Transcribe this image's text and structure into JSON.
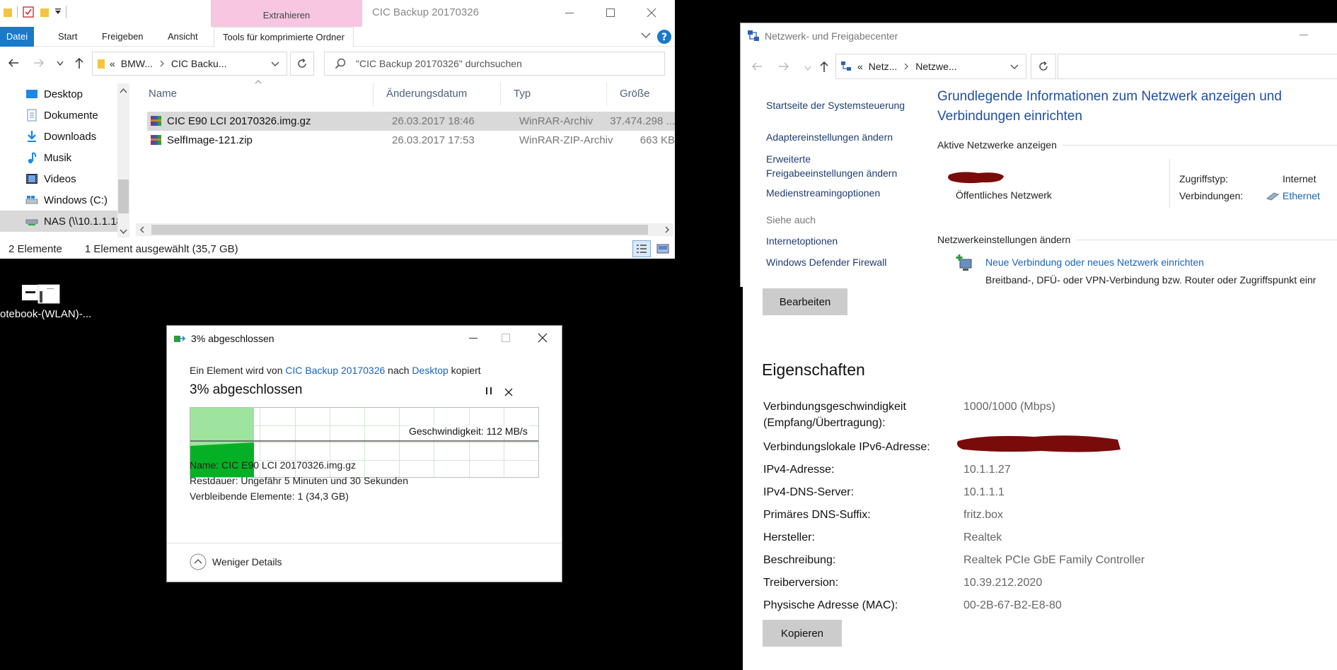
{
  "explorer": {
    "title": "CIC Backup 20170326",
    "contextual_tab": "Extrahieren",
    "ribbon_tabs": [
      "Datei",
      "Start",
      "Freigeben",
      "Ansicht",
      "Tools für komprimierte Ordner"
    ],
    "breadcrumb_sep": "«",
    "breadcrumb": [
      "BMW...",
      "CIC Backu..."
    ],
    "search_placeholder": "\"CIC Backup 20170326\" durchsuchen",
    "nav_items": [
      {
        "label": "Desktop",
        "icon": "desktop-folder-icon"
      },
      {
        "label": "Dokumente",
        "icon": "documents-folder-icon"
      },
      {
        "label": "Downloads",
        "icon": "downloads-folder-icon"
      },
      {
        "label": "Musik",
        "icon": "music-folder-icon"
      },
      {
        "label": "Videos",
        "icon": "videos-folder-icon"
      },
      {
        "label": "Windows (C:)",
        "icon": "drive-icon"
      },
      {
        "label": "NAS (\\\\10.1.1.18",
        "icon": "network-drive-icon"
      }
    ],
    "columns": [
      "Name",
      "Änderungsdatum",
      "Typ",
      "Größe"
    ],
    "files": [
      {
        "name": "CIC E90 LCI 20170326.img.gz",
        "date": "26.03.2017 18:46",
        "type": "WinRAR-Archiv",
        "size": "37.474.298 ...",
        "selected": true
      },
      {
        "name": "SelfImage-121.zip",
        "date": "26.03.2017 17:53",
        "type": "WinRAR-ZIP-Archiv",
        "size": "663 KB",
        "selected": false
      }
    ],
    "status_count": "2 Elemente",
    "status_selection": "1 Element ausgewählt (35,7 GB)"
  },
  "desktop_icon": {
    "label": "otebook-(WLAN)-..."
  },
  "copy_dialog": {
    "title": "3% abgeschlossen",
    "line_prefix": "Ein Element wird von ",
    "source": "CIC Backup 20170326",
    "line_mid": " nach ",
    "destination": "Desktop",
    "line_suffix": " kopiert",
    "heading": "3% abgeschlossen",
    "progress_percent": 3,
    "speed_text": "Geschwindigkeit: 112 MB/s",
    "name_label": "Name:",
    "name_value": "CIC E90 LCI 20170326.img.gz",
    "remaining_label": "Restdauer:",
    "remaining_value": "Ungefähr 5 Minuten und 30 Sekunden",
    "items_label": "Verbleibende Elemente:",
    "items_value": "1 (34,3 GB)",
    "less_details": "Weniger Details"
  },
  "network_center": {
    "title": "Netzwerk- und Freigabecenter",
    "breadcrumb_sep": "«",
    "breadcrumb": [
      "Netz...",
      "Netzwe..."
    ],
    "left_links": [
      "Startseite der Systemsteuerung",
      "Adaptereinstellungen ändern",
      "Erweiterte\nFreigabeeinstellungen ändern",
      "Medienstreamingoptionen"
    ],
    "see_also": "Siehe auch",
    "see_also_links": [
      "Internetoptionen",
      "Windows Defender Firewall"
    ],
    "heading": "Grundlegende Informationen zum Netzwerk anzeigen und Verbindungen einrichten",
    "active_networks": "Aktive Netzwerke anzeigen",
    "network_type": "Öffentliches Netzwerk",
    "access_type_label": "Zugriffstyp:",
    "access_type_value": "Internet",
    "connections_label": "Verbindungen:",
    "connections_value": "Ethernet",
    "change_settings": "Netzwerkeinstellungen ändern",
    "wizard_link": "Neue Verbindung oder neues Netzwerk einrichten",
    "wizard_desc": "Breitband-, DFÜ- oder VPN-Verbindung bzw. Router oder Zugriffspunkt einr"
  },
  "properties": {
    "edit_button": "Bearbeiten",
    "heading": "Eigenschaften",
    "rows": [
      {
        "label": "Verbindungsgeschwindigkeit\n(Empfang/Übertragung):",
        "value": "1000/1000 (Mbps)"
      },
      {
        "label": "Verbindungslokale IPv6-Adresse:",
        "value": ""
      },
      {
        "label": "IPv4-Adresse:",
        "value": "10.1.1.27"
      },
      {
        "label": "IPv4-DNS-Server:",
        "value": "10.1.1.1"
      },
      {
        "label": "Primäres DNS-Suffix:",
        "value": "fritz.box"
      },
      {
        "label": "Hersteller:",
        "value": "Realtek"
      },
      {
        "label": "Beschreibung:",
        "value": "Realtek PCIe GbE Family Controller"
      },
      {
        "label": "Treiberversion:",
        "value": "10.39.212.2020"
      },
      {
        "label": "Physische Adresse (MAC):",
        "value": "00-2B-67-B2-E8-80"
      }
    ],
    "copy_button": "Kopieren"
  },
  "colors": {
    "accent": "#1979ca",
    "link": "#1a63b8",
    "progress_green": "#06b025",
    "context_tab": "#f7c6e0",
    "redaction": "#7a0b0b"
  }
}
